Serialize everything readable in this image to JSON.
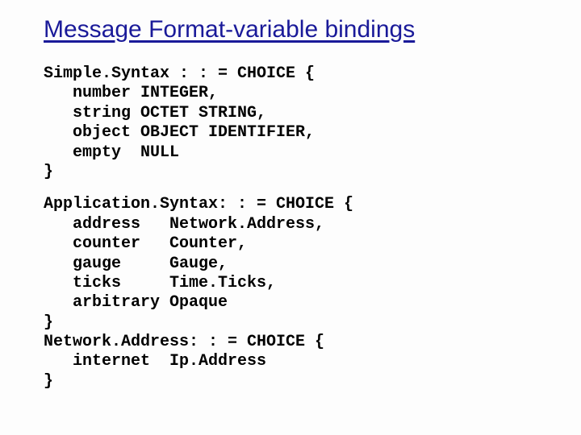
{
  "title": "Message Format-variable bindings",
  "code1": "Simple.Syntax : : = CHOICE {\n   number INTEGER,\n   string OCTET STRING,\n   object OBJECT IDENTIFIER,\n   empty  NULL\n}",
  "code2": "Application.Syntax: : = CHOICE {\n   address   Network.Address,\n   counter   Counter,\n   gauge     Gauge,\n   ticks     Time.Ticks,\n   arbitrary Opaque\n}\nNetwork.Address: : = CHOICE {\n   internet  Ip.Address\n}"
}
